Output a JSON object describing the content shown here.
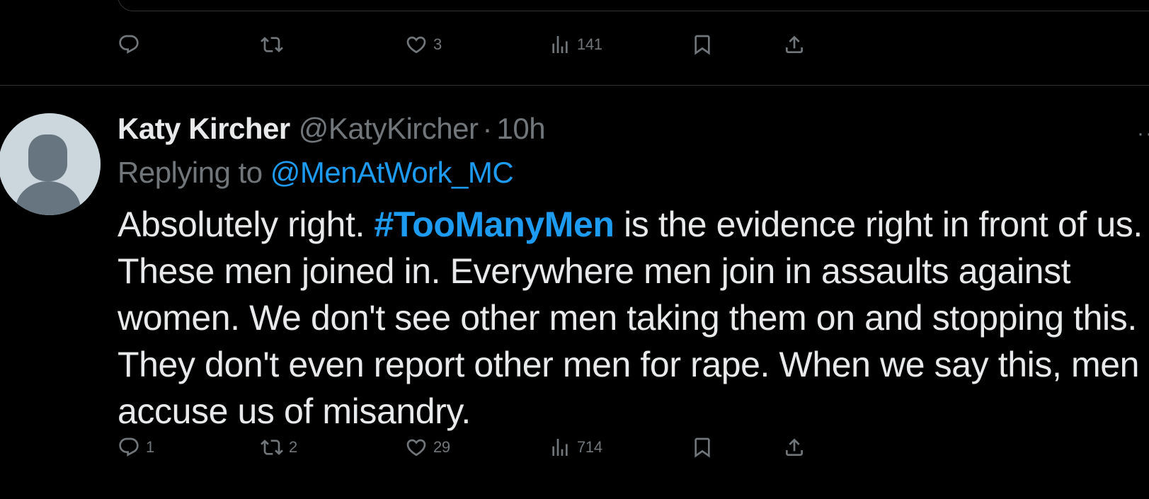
{
  "previous_tweet": {
    "actions": {
      "reply_count": "",
      "retweet_count": "",
      "like_count": "3",
      "views_count": "141"
    }
  },
  "tweet": {
    "author_name": "Katy Kircher",
    "author_handle": "@KatyKircher",
    "separator": "·",
    "time": "10h",
    "replying_prefix": "Replying to ",
    "replying_to": "@MenAtWork_MC",
    "text_before": "Absolutely right. ",
    "hashtag": "#TooManyMen",
    "text_after": " is the evidence right in front of us. These men joined in. Everywhere men join in assaults against women. We don't see other men taking them on and stopping this. They don't even report other men for rape. When we say this, men accuse us of misandry.",
    "actions": {
      "reply_count": "1",
      "retweet_count": "2",
      "like_count": "29",
      "views_count": "714"
    }
  },
  "icons": {
    "reply": "reply-icon",
    "retweet": "retweet-icon",
    "like": "heart-icon",
    "views": "views-icon",
    "bookmark": "bookmark-icon",
    "share": "share-icon",
    "more": "more-icon",
    "avatar": "default-avatar-icon"
  },
  "colors": {
    "background": "#000000",
    "text": "#e7e9ea",
    "muted": "#71767b",
    "accent": "#1d9bf0",
    "divider": "#2f3336"
  }
}
